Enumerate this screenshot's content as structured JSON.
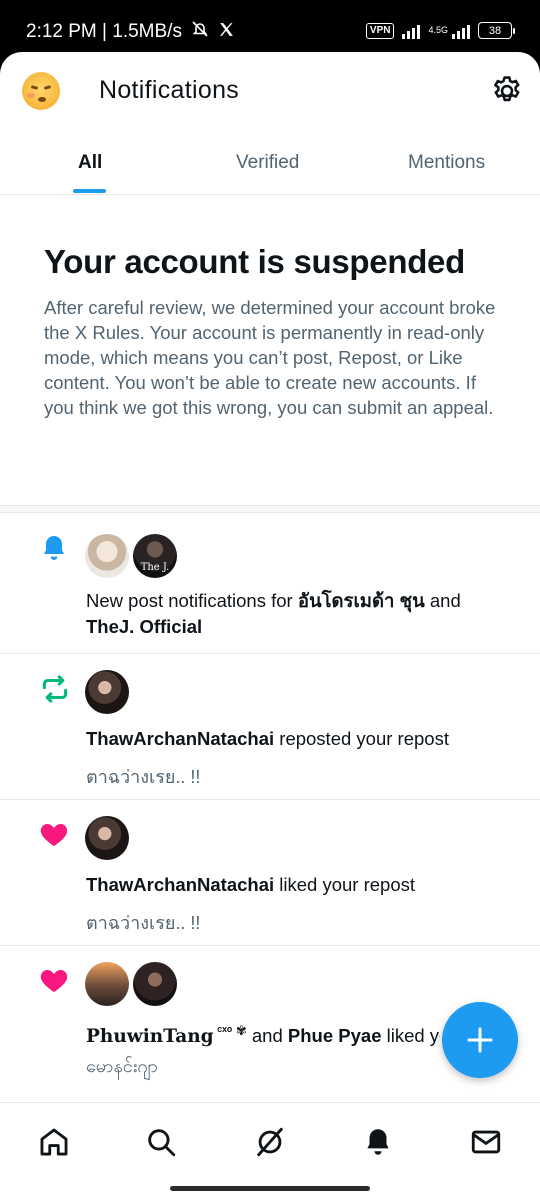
{
  "status_bar": {
    "time_speed": "2:12 PM | 1.5MB/s",
    "vpn": "VPN",
    "network": "4.5G",
    "battery": "38"
  },
  "header": {
    "title": "Notifications"
  },
  "tabs": [
    {
      "label": "All",
      "active": true
    },
    {
      "label": "Verified",
      "active": false
    },
    {
      "label": "Mentions",
      "active": false
    }
  ],
  "suspension": {
    "title": "Your account is suspended",
    "body": "After careful review, we determined your account broke the X Rules. Your account is permanently in read-only mode, which means you can’t post, Repost, or Like content. You won’t be able to create new accounts. If you think we got this wrong, you can submit an appeal."
  },
  "notifications": [
    {
      "type": "bell",
      "avatar_label": "The J.",
      "text_prefix": "New post notifications for ",
      "name1": "อันโดรเมด้า ชุน",
      "joiner": " and ",
      "name2": "TheJ. Official"
    },
    {
      "type": "repost",
      "name": "ThawArchanNatachai",
      "action": " reposted your repost",
      "sub": "ตาฉว่างเรย.. !!"
    },
    {
      "type": "like",
      "name": "ThawArchanNatachai",
      "action": " liked your repost",
      "sub": "ตาฉว่างเรย.. !!"
    },
    {
      "type": "like",
      "name1": "PhuwinTang",
      "name1_suffix": " ᶜˣᵒ ✾",
      "joiner": " and ",
      "name2": "Phue Pyae",
      "action": " liked your repost",
      "sub": "မောနင်းဂျာ"
    }
  ],
  "colors": {
    "accent": "#1d9bf0",
    "repost": "#00ba7c",
    "like": "#f91880",
    "secondary_text": "#536471"
  },
  "icons": {
    "settings": "gear-icon",
    "home": "home-icon",
    "search": "search-icon",
    "grok": "grok-icon",
    "notifications": "bell-icon",
    "messages": "mail-icon",
    "compose": "plus-icon"
  }
}
